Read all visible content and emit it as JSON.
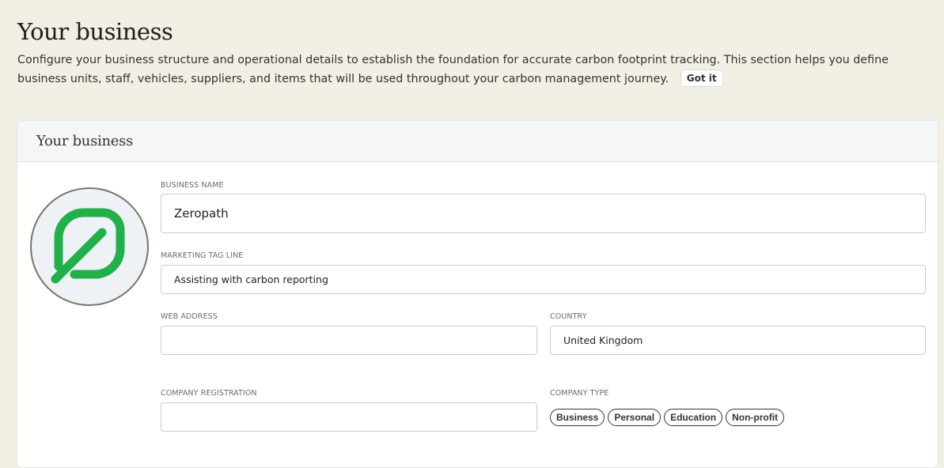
{
  "header": {
    "title": "Your business",
    "description": "Configure your business structure and operational details to establish the foundation for accurate carbon footprint tracking. This section helps you define business units, staff, vehicles, suppliers, and items that will be used throughout your carbon management journey.",
    "got_it_label": "Got it"
  },
  "card": {
    "title": "Your business",
    "logo_icon": "leaf-icon",
    "logo_color": "#22b04b"
  },
  "form": {
    "business_name": {
      "label": "BUSINESS NAME",
      "value": "Zeropath"
    },
    "tag_line": {
      "label": "MARKETING TAG LINE",
      "value": "Assisting with carbon reporting"
    },
    "web_address": {
      "label": "WEB ADDRESS",
      "value": ""
    },
    "country": {
      "label": "COUNTRY",
      "value": "United Kingdom"
    },
    "company_registration": {
      "label": "COMPANY REGISTRATION",
      "value": ""
    },
    "company_type": {
      "label": "COMPANY TYPE",
      "options": [
        "Business",
        "Personal",
        "Education",
        "Non-profit"
      ]
    }
  }
}
